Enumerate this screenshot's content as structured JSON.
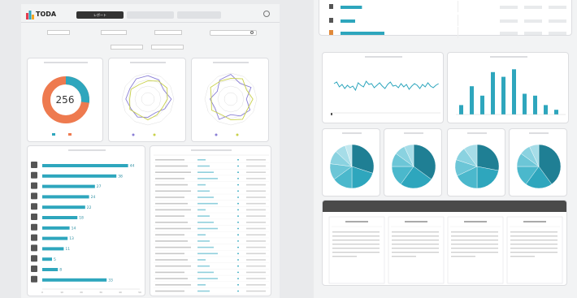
{
  "header": {
    "logo_text": "TODA",
    "tabs": [
      {
        "label": "レポート",
        "active": true
      },
      {
        "label": "",
        "active": false
      },
      {
        "label": "",
        "active": false
      }
    ]
  },
  "filters": {
    "dropdowns": [
      "",
      "",
      "",
      "",
      "",
      "",
      ""
    ],
    "search_placeholder": ""
  },
  "donut": {
    "value": "256",
    "colors": [
      "#2ea6bd",
      "#ee7a4f"
    ],
    "fraction_teal": 0.27
  },
  "bar_list": {
    "values": [
      44,
      38,
      27,
      24,
      22,
      18,
      14,
      13,
      11,
      5,
      8,
      33
    ],
    "axis_ticks": [
      "0",
      "10",
      "20",
      "30",
      "40",
      "50"
    ],
    "icons": [
      "wrench-icon",
      "person-icon",
      "person-icon",
      "hazard-icon",
      "person-icon",
      "car-icon",
      "person-icon",
      "arm-icon",
      "hand-icon",
      "person-icon",
      "worker-icon",
      "warning-icon"
    ],
    "side_labels": [
      "",
      "",
      "",
      "",
      "",
      "",
      "",
      "",
      "",
      "",
      "",
      ""
    ]
  },
  "accent": "#2ea6bd",
  "right": {
    "card_titles": [
      "",
      "",
      "",
      "",
      "",
      "",
      "",
      "",
      ""
    ],
    "advice_header": "",
    "advice_items": [
      "",
      "",
      "",
      ""
    ]
  }
}
